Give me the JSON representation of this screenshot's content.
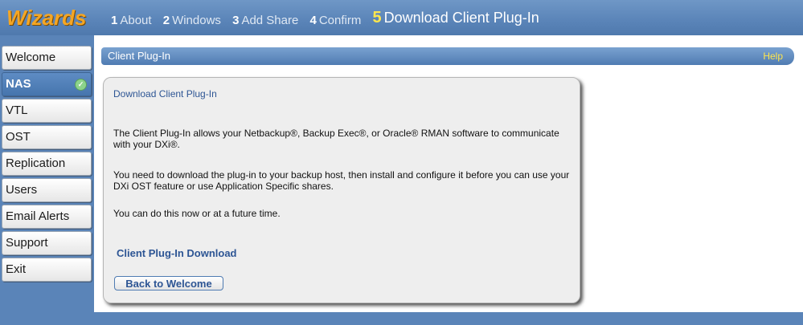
{
  "header": {
    "logo": "Wizards",
    "steps": [
      {
        "num": "1",
        "label": "About"
      },
      {
        "num": "2",
        "label": "Windows"
      },
      {
        "num": "3",
        "label": "Add Share"
      },
      {
        "num": "4",
        "label": "Confirm"
      },
      {
        "num": "5",
        "label": "Download Client Plug-In"
      }
    ]
  },
  "sidebar": {
    "items": [
      {
        "label": "Welcome"
      },
      {
        "label": "NAS",
        "icon": "check-circle-icon"
      },
      {
        "label": "VTL"
      },
      {
        "label": "OST"
      },
      {
        "label": "Replication"
      },
      {
        "label": "Users"
      },
      {
        "label": "Email Alerts"
      },
      {
        "label": "Support"
      },
      {
        "label": "Exit"
      }
    ]
  },
  "panel": {
    "title": "Client Plug-In",
    "help": "Help"
  },
  "card": {
    "title": "Download Client Plug-In",
    "paragraphs": [
      "The Client Plug-In allows your Netbackup®, Backup Exec®, or Oracle® RMAN software to communicate with your DXi®.",
      "You need to download the plug-in to your backup host, then install and configure it before you can use your DXi OST feature or use Application Specific shares.",
      "You can do this now or at a future time."
    ],
    "download_link": "Client Plug-In Download",
    "back_button": "Back to Welcome"
  },
  "colors": {
    "accent_blue": "#5a84b8",
    "logo_orange": "#f5a623",
    "active_step_yellow": "#ffe64d",
    "link_blue": "#2d5594"
  }
}
